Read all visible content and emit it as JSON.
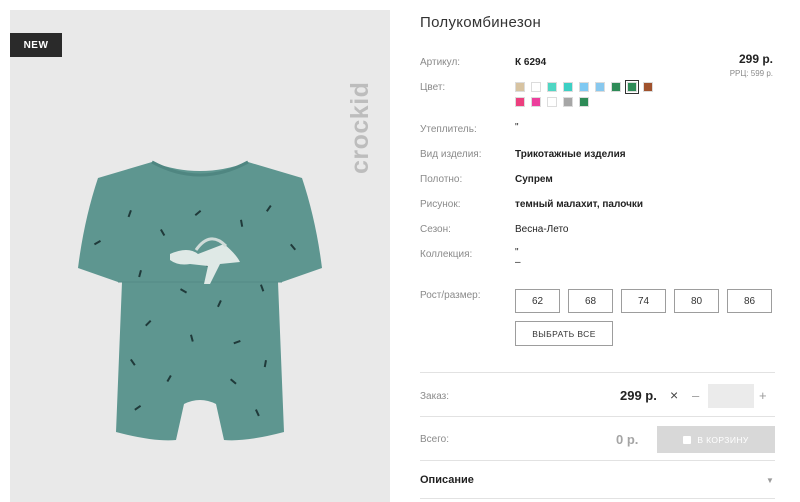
{
  "badge": {
    "label": "NEW"
  },
  "brand": {
    "name": "crockid"
  },
  "product": {
    "title": "Полукомбинезон",
    "price": "299 р.",
    "rrp": "РРЦ: 599 р."
  },
  "attributes": {
    "article": {
      "label": "Артикул:",
      "value": "К 6294"
    },
    "color": {
      "label": "Цвет:"
    },
    "insulation": {
      "label": "Утеплитель:",
      "value": "\""
    },
    "item_type": {
      "label": "Вид изделия:",
      "value": "Трикотажные изделия"
    },
    "fabric": {
      "label": "Полотно:",
      "value": "Супрем"
    },
    "print": {
      "label": "Рисунок:",
      "value": "темный малахит, палочки"
    },
    "season": {
      "label": "Сезон:",
      "value": "Весна-Лето"
    },
    "collection": {
      "label": "Коллекция:",
      "value": "\"",
      "value2": "–"
    }
  },
  "swatches": {
    "colors": [
      "#d7c3a1",
      "#ffffff",
      "#4fd6c3",
      "#3cd0c4",
      "#7fc9f2",
      "#88c8ee",
      "#2e8b57",
      "#2e8b57",
      "#a0522d",
      "#ec3f7e",
      "#ec3f9c",
      "#ffffff",
      "#a6a6a6",
      "#2e8b57"
    ],
    "selected_index": 7
  },
  "sizes": {
    "label": "Рост/размер:",
    "options": [
      "62",
      "68",
      "74",
      "80",
      "86"
    ],
    "select_all": "ВЫБРАТЬ ВСЕ"
  },
  "order": {
    "label": "Заказ:",
    "price": "299 р.",
    "times": "×",
    "minus": "–",
    "plus": "+",
    "quantity": ""
  },
  "total": {
    "label": "Всего:",
    "value": "0 р.",
    "cart_button": "В КОРЗИНУ",
    "cart_icon": "shopping-bag-icon"
  },
  "description": {
    "label": "Описание",
    "caret": "▼"
  }
}
